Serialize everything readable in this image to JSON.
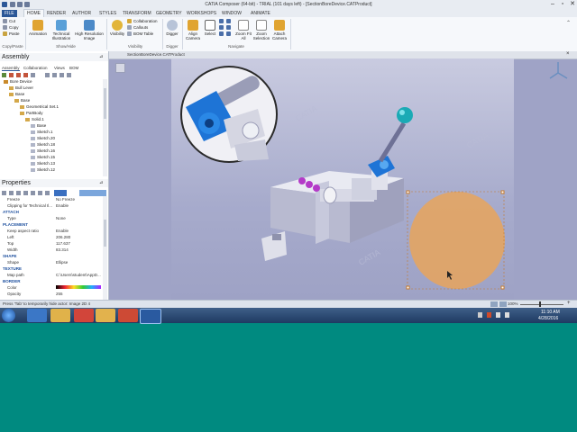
{
  "window": {
    "title": "CATIA Composer (64-bit) - TRIAL (101 days left) - [SectionBoreDevice.CATProduct]"
  },
  "tabs": [
    "FILE",
    "HOME",
    "RENDER",
    "AUTHOR",
    "STYLES",
    "TRANSFORM",
    "GEOMETRY",
    "WORKSHOPS",
    "WINDOW",
    "ANIMATE"
  ],
  "active_tab": "HOME",
  "ribbon": {
    "copy_paste": {
      "cut": "Cut",
      "copy": "Copy",
      "paste": "Paste",
      "label": "Copy/Paste"
    },
    "show_hide": {
      "animation": "Animation",
      "technical_illustration": "Technical Illustration",
      "high_resolution_image": "High Resolution Image",
      "label": "Show/Hide"
    },
    "visibility": {
      "visibility": "Visibility",
      "collaboration": "Collaboration",
      "callouts": "Callouts",
      "bom_table": "BOM Table",
      "label": "Visibility"
    },
    "digger": {
      "digger": "Digger",
      "label": "Digger"
    },
    "navigate": {
      "align_camera": "Align Camera",
      "select": "Select",
      "zoom_fit_all": "Zoom Fit All",
      "zoom_selection": "Zoom Selection",
      "attach_camera": "Attach Camera",
      "label": "Navigate"
    }
  },
  "assembly_pane": {
    "title": "Assembly",
    "subtabs": [
      "Assembly",
      "Collaboration",
      "Views",
      "BOM"
    ],
    "tree": [
      {
        "label": "Bore Device",
        "level": 0
      },
      {
        "label": "Bull Lever",
        "level": 1
      },
      {
        "label": "Base",
        "level": 1
      },
      {
        "label": "Base",
        "level": 2
      },
      {
        "label": "Geometrical Set.1",
        "level": 3
      },
      {
        "label": "PartBody",
        "level": 3
      },
      {
        "label": "Solid.1",
        "level": 4
      },
      {
        "label": "Base",
        "level": 5
      },
      {
        "label": "Sketch.1",
        "level": 5
      },
      {
        "label": "Sketch.20",
        "level": 5
      },
      {
        "label": "Sketch.18",
        "level": 5
      },
      {
        "label": "Sketch.16",
        "level": 5
      },
      {
        "label": "Sketch.15",
        "level": 5
      },
      {
        "label": "Sketch.13",
        "level": 5
      },
      {
        "label": "Sketch.12",
        "level": 5
      }
    ]
  },
  "properties_pane": {
    "title": "Properties",
    "rows": [
      {
        "key": "Freeze",
        "value": "No Freeze"
      },
      {
        "key": "Clipping for Technical Il...",
        "value": "Enable"
      }
    ],
    "attach_label": "ATTACH",
    "attach": [
      {
        "key": "Type",
        "value": "None"
      }
    ],
    "placement_label": "PLACEMENT",
    "placement": [
      {
        "key": "Keep aspect ratio",
        "value": "Enable"
      },
      {
        "key": "Left",
        "value": "206.280"
      },
      {
        "key": "Top",
        "value": "117.637"
      },
      {
        "key": "Width",
        "value": "83.314"
      }
    ],
    "shape_label": "SHAPE",
    "shape": [
      {
        "key": "Shape",
        "value": "Ellipse"
      }
    ],
    "texture_label": "TEXTURE",
    "texture": [
      {
        "key": "Map path",
        "value": "C:\\Users\\student\\AppD..."
      }
    ],
    "border_label": "BORDER",
    "border": [
      {
        "key": "Color",
        "value": ""
      },
      {
        "key": "Opacity",
        "value": "255"
      }
    ]
  },
  "viewport": {
    "document_tab": "SectionBoreDevice.CATProduct",
    "watermark": "CATIA",
    "highlight_color": "#e8a45c"
  },
  "status": {
    "text": "Press 'Tab' to temporarily hide actor: Image 2D 4",
    "zoom": "100%"
  },
  "taskbar": {
    "time": "11:10 AM",
    "date": "4/28/2016"
  }
}
